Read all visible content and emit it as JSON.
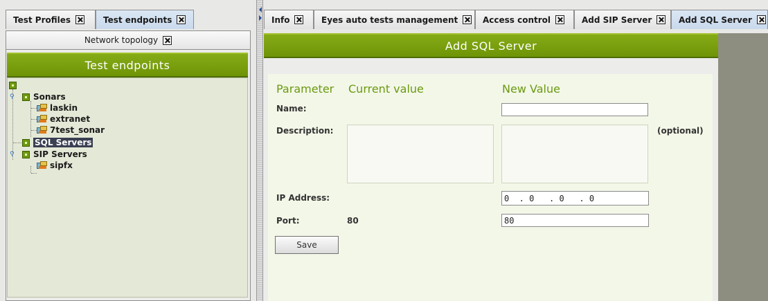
{
  "left_tabs": [
    {
      "label": "Test Profiles",
      "active": false
    },
    {
      "label": "Test endpoints",
      "active": true
    }
  ],
  "topology_tab": {
    "label": "Network topology"
  },
  "left_header": {
    "title": "Test endpoints"
  },
  "tree": {
    "sonars": {
      "label": "Sonars",
      "children": [
        "laskin",
        "extranet",
        "7test_sonar"
      ]
    },
    "sql_servers": {
      "label": "SQL Servers",
      "selected": true
    },
    "sip_servers": {
      "label": "SIP Servers",
      "children": [
        "sipfx"
      ]
    }
  },
  "right_tabs": [
    {
      "label": "Info",
      "active": false
    },
    {
      "label": "Eyes auto tests management",
      "active": false
    },
    {
      "label": "Access control",
      "active": false
    },
    {
      "label": "Add SIP Server",
      "active": false
    },
    {
      "label": "Add SQL Server",
      "active": true
    }
  ],
  "form": {
    "title": "Add SQL Server",
    "columns": {
      "parameter": "Parameter",
      "current": "Current value",
      "new": "New Value"
    },
    "name_label": "Name:",
    "name_value": "",
    "description_label": "Description:",
    "description_current": "",
    "description_new": "",
    "optional_label": "(optional)",
    "ip_label": "IP Address:",
    "ip_value": "0  . 0   . 0   . 0",
    "port_label": "Port:",
    "port_current": "80",
    "port_value": "80",
    "save_label": "Save"
  },
  "colors": {
    "accent_green": "#6e9406",
    "column_header_green": "#6a9a10",
    "tree_selection": "#3a3f52",
    "active_tab_blue": "#c9d9ec"
  },
  "icons": [
    "close-tab-icon",
    "tree-node-icon",
    "server-icon",
    "tree-toggle-icon",
    "splitter-arrow-icon"
  ]
}
